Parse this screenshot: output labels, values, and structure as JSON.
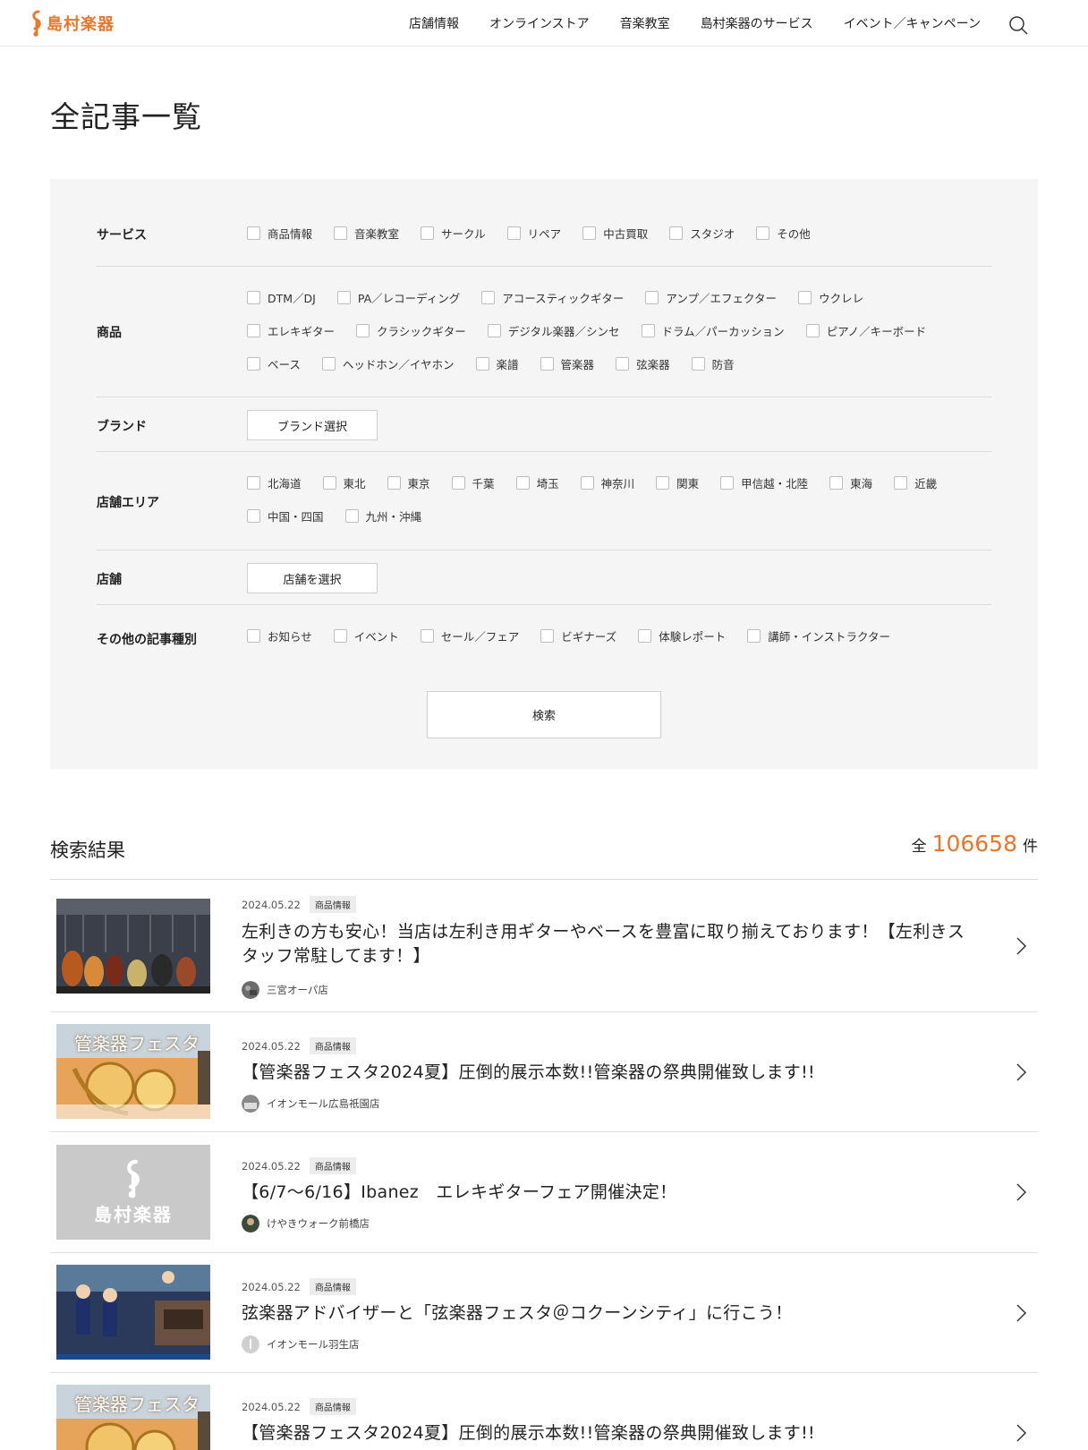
{
  "header": {
    "logo_text": "島村楽器",
    "nav": [
      "店舗情報",
      "オンラインストア",
      "音楽教室",
      "島村楽器のサービス",
      "イベント／キャンペーン"
    ],
    "search_icon": "search-icon"
  },
  "page_title": "全記事一覧",
  "filters": {
    "service": {
      "label": "サービス",
      "options": [
        "商品情報",
        "音楽教室",
        "サークル",
        "リペア",
        "中古買取",
        "スタジオ",
        "その他"
      ]
    },
    "product": {
      "label": "商品",
      "lines": [
        [
          "DTM／DJ",
          "PA／レコーディング",
          "アコースティックギター",
          "アンプ／エフェクター",
          "ウクレレ"
        ],
        [
          "エレキギター",
          "クラシックギター",
          "デジタル楽器／シンセ",
          "ドラム／パーカッション",
          "ピアノ／キーボード"
        ],
        [
          "ベース",
          "ヘッドホン／イヤホン",
          "楽譜",
          "管楽器",
          "弦楽器",
          "防音"
        ]
      ]
    },
    "brand": {
      "label": "ブランド",
      "button": "ブランド選択"
    },
    "area": {
      "label": "店舗エリア",
      "lines": [
        [
          "北海道",
          "東北",
          "東京",
          "千葉",
          "埼玉",
          "神奈川",
          "関東",
          "甲信越・北陸",
          "東海",
          "近畿"
        ],
        [
          "中国・四国",
          "九州・沖縄"
        ]
      ]
    },
    "store": {
      "label": "店舗",
      "button": "店舗を選択"
    },
    "other": {
      "label": "その他の記事種別",
      "options": [
        "お知らせ",
        "イベント",
        "セール／フェア",
        "ビギナーズ",
        "体験レポート",
        "講師・インストラクター"
      ]
    },
    "submit": "検索"
  },
  "results": {
    "title": "検索結果",
    "count_prefix": "全",
    "count": "106658",
    "count_suffix": "件",
    "articles": [
      {
        "date": "2024.05.22",
        "tag": "商品情報",
        "title": "左利きの方も安心！当店は左利き用ギターやベースを豊富に取り揃えております！【左利きスタッフ常駐してます！】",
        "store": "三宮オーパ店"
      },
      {
        "date": "2024.05.22",
        "tag": "商品情報",
        "title": "【管楽器フェスタ2024夏】圧倒的展示本数!!管楽器の祭典開催致します!!",
        "store": "イオンモール広島祇園店",
        "thumb_text": "管楽器フェスタ"
      },
      {
        "date": "2024.05.22",
        "tag": "商品情報",
        "title": "【6/7〜6/16】Ibanez　エレキギターフェア開催決定！",
        "store": "けやきウォーク前橋店",
        "thumb_text": "島村楽器"
      },
      {
        "date": "2024.05.22",
        "tag": "商品情報",
        "title": "弦楽器アドバイザーと「弦楽器フェスタ＠コクーンシティ」に行こう！",
        "store": "イオンモール羽生店"
      },
      {
        "date": "2024.05.22",
        "tag": "商品情報",
        "title": "【管楽器フェスタ2024夏】圧倒的展示本数!!管楽器の祭典開催致します!!",
        "store": "",
        "thumb_text": "管楽器フェスタ"
      }
    ]
  },
  "colors": {
    "accent": "#e8772e",
    "panel_bg": "#f5f5f5"
  }
}
